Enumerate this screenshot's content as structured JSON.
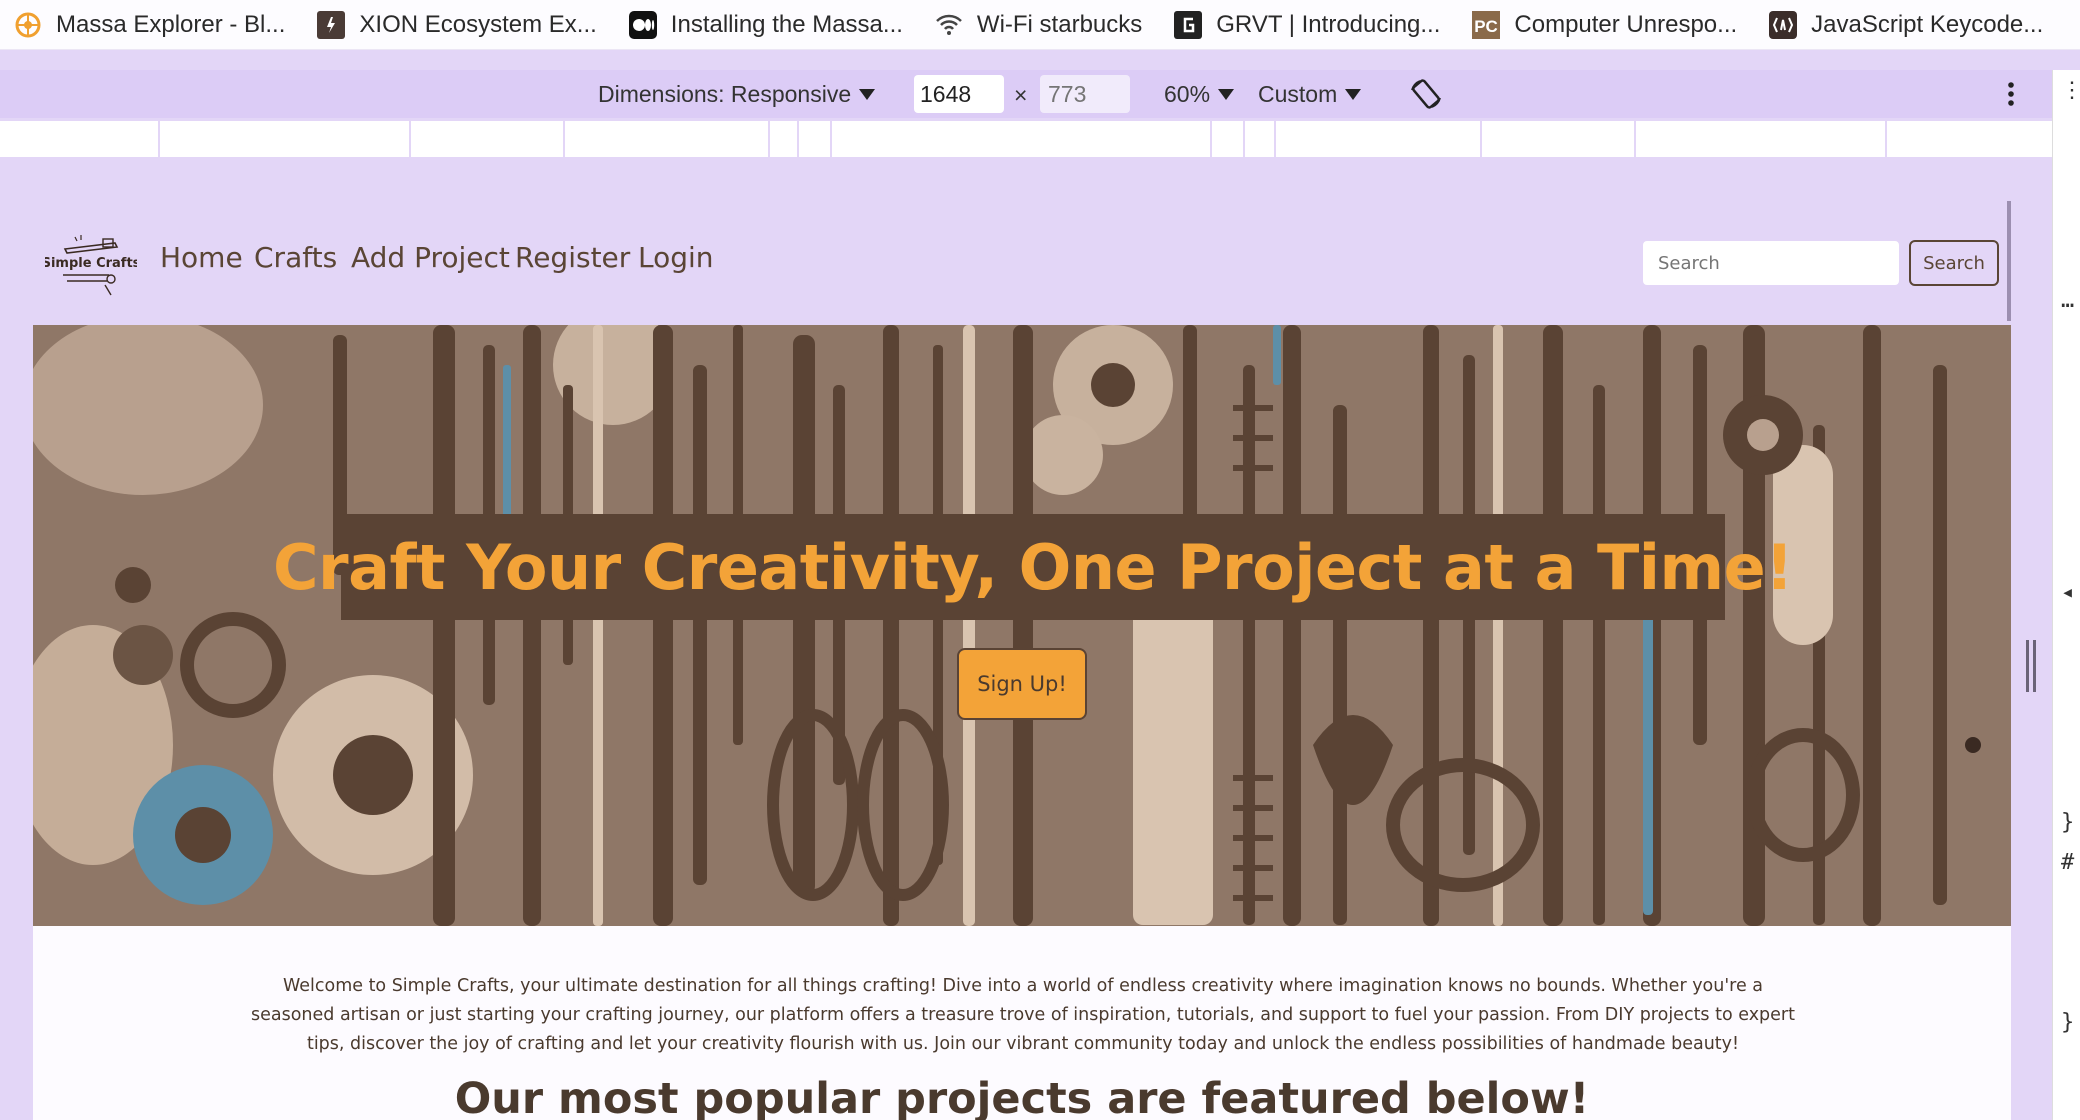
{
  "browser": {
    "bookmarks": [
      {
        "label": "Massa Explorer - Bl...",
        "icon": "massa-icon"
      },
      {
        "label": "XION Ecosystem Ex...",
        "icon": "xion-icon"
      },
      {
        "label": "Installing the Massa...",
        "icon": "medium-icon"
      },
      {
        "label": "Wi-Fi starbucks",
        "icon": "wifi-icon"
      },
      {
        "label": "GRVT | Introducing...",
        "icon": "grvt-icon"
      },
      {
        "label": "Computer Unrespo...",
        "icon": "pc-icon"
      },
      {
        "label": "JavaScript Keycode...",
        "icon": "js-keycode-icon"
      }
    ]
  },
  "device_toolbar": {
    "dimensions_label": "Dimensions: Responsive",
    "width": "1648",
    "times": "×",
    "height_placeholder": "773",
    "zoom": "60%",
    "throttle": "Custom"
  },
  "site": {
    "logo_text": "Simple Crafts",
    "nav": {
      "home": "Home",
      "crafts": "Crafts",
      "add_project": "Add Project",
      "register": "Register",
      "login": "Login"
    },
    "search": {
      "placeholder": "Search",
      "button": "Search"
    },
    "hero": {
      "title": "Craft Your Creativity, One Project at a Time!",
      "signup": "Sign Up!"
    },
    "intro": "Welcome to Simple Crafts, your ultimate destination for all things crafting! Dive into a world of endless creativity where imagination knows no bounds. Whether you're a seasoned artisan or just starting your crafting journey, our platform offers a treasure trove of inspiration, tutorials, and support to fuel your passion. From DIY projects to expert tips, discover the joy of crafting and let your creativity flourish with us. Join our vibrant community today and unlock the endless possibilities of handmade beauty!",
    "popular_heading": "Our most popular projects are featured below!"
  },
  "colors": {
    "accent": "#f3a338",
    "brown": "#5a4334",
    "lavender": "#e3d6f7"
  }
}
